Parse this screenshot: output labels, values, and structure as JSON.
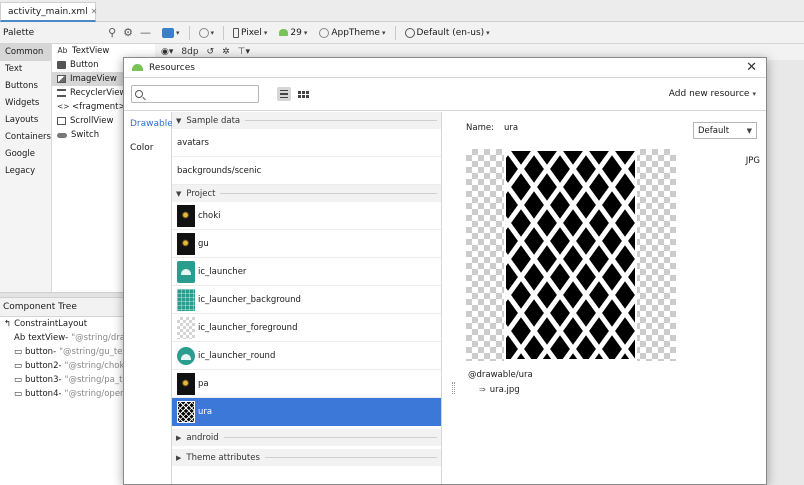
{
  "ide": {
    "file_tab": "activity_main.xml",
    "palette_title": "Palette",
    "palette_categories": [
      "Common",
      "Text",
      "Buttons",
      "Widgets",
      "Layouts",
      "Containers",
      "Google",
      "Legacy"
    ],
    "palette_widgets": [
      {
        "icon": "Ab",
        "label": "TextView"
      },
      {
        "icon": "button",
        "label": "Button"
      },
      {
        "icon": "image",
        "label": "ImageView"
      },
      {
        "icon": "list",
        "label": "RecyclerView"
      },
      {
        "icon": "<>",
        "label": "<fragment>"
      },
      {
        "icon": "scroll",
        "label": "ScrollView"
      },
      {
        "icon": "switch",
        "label": "Switch"
      }
    ],
    "toolbar": {
      "device": "Pixel",
      "api": "29",
      "theme": "AppTheme",
      "locale": "Default (en-us)",
      "margin": "8dp"
    },
    "component_tree_title": "Component Tree",
    "tree": [
      {
        "type": "",
        "name": "ConstraintLayout",
        "id": ""
      },
      {
        "type": "Ab",
        "name": "textView-",
        "id": "\"@string/draw_"
      },
      {
        "type": "▭",
        "name": "button-",
        "id": "\"@string/gu_text"
      },
      {
        "type": "▭",
        "name": "button2-",
        "id": "\"@string/choki_"
      },
      {
        "type": "▭",
        "name": "button3-",
        "id": "\"@string/pa_tex"
      },
      {
        "type": "▭",
        "name": "button4-",
        "id": "\"@string/open_t"
      }
    ]
  },
  "dialog": {
    "title": "Resources",
    "search_placeholder": "",
    "add_resource_label": "Add new resource",
    "side_tabs": [
      "Drawable",
      "Color"
    ],
    "groups": {
      "sample": {
        "label": "Sample data",
        "items": [
          "avatars",
          "backgrounds/scenic"
        ]
      },
      "project": {
        "label": "Project",
        "items": [
          {
            "name": "choki",
            "thumb": "dark"
          },
          {
            "name": "gu",
            "thumb": "dark"
          },
          {
            "name": "ic_launcher",
            "thumb": "launcher"
          },
          {
            "name": "ic_launcher_background",
            "thumb": "bg-grid"
          },
          {
            "name": "ic_launcher_foreground",
            "thumb": "checker"
          },
          {
            "name": "ic_launcher_round",
            "thumb": "round"
          },
          {
            "name": "pa",
            "thumb": "dark"
          },
          {
            "name": "ura",
            "thumb": "lattice",
            "selected": true
          }
        ]
      },
      "android": {
        "label": "android"
      },
      "theme": {
        "label": "Theme attributes"
      }
    },
    "detail": {
      "name_label": "Name:",
      "name_value": "ura",
      "density": "Default",
      "format": "JPG",
      "path": "@drawable/ura",
      "file": "ura.jpg",
      "file_link_glyph": "⇒"
    }
  }
}
